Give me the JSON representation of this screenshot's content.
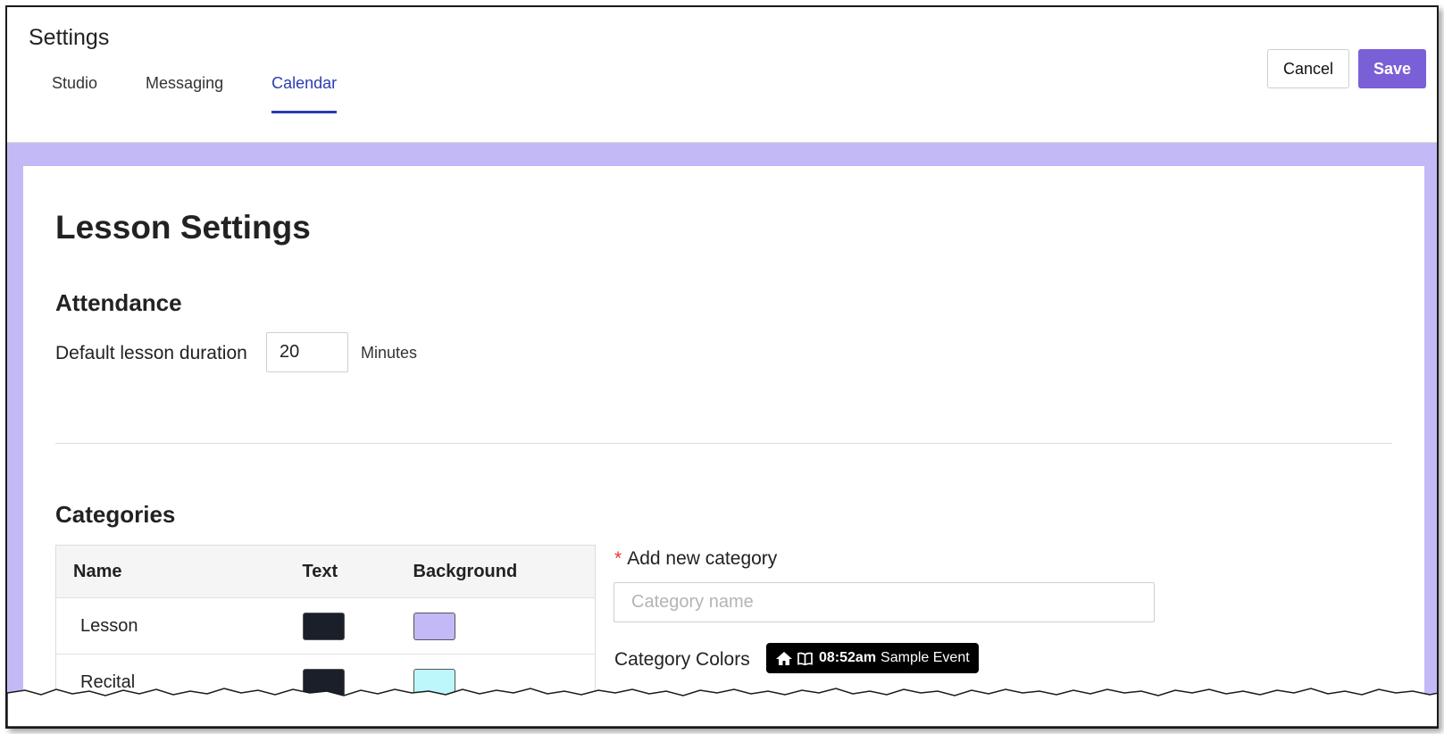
{
  "header": {
    "title": "Settings",
    "tabs": [
      {
        "label": "Studio",
        "active": false
      },
      {
        "label": "Messaging",
        "active": false
      },
      {
        "label": "Calendar",
        "active": true
      }
    ],
    "cancel_label": "Cancel",
    "save_label": "Save"
  },
  "page": {
    "heading": "Lesson Settings",
    "attendance": {
      "title": "Attendance",
      "duration_label": "Default lesson duration",
      "duration_value": "20",
      "duration_unit": "Minutes"
    },
    "categories": {
      "title": "Categories",
      "columns": [
        "Name",
        "Text",
        "Background"
      ],
      "rows": [
        {
          "name": "Lesson",
          "text_color": "#1b1f29",
          "background_color": "#c3b9f6"
        },
        {
          "name": "Recital",
          "text_color": "#1b1f29",
          "background_color": "#bdf7fb"
        }
      ],
      "add_label": "Add new category",
      "required_mark": "*",
      "name_placeholder": "Category name",
      "colors_label": "Category Colors",
      "preview": {
        "icons": [
          "home-icon",
          "book-icon"
        ],
        "time": "08:52am",
        "title": "Sample Event"
      }
    }
  },
  "colors": {
    "accent": "#7b5fd6",
    "tab_active": "#2a3db3",
    "page_background": "#c3b9f6"
  }
}
